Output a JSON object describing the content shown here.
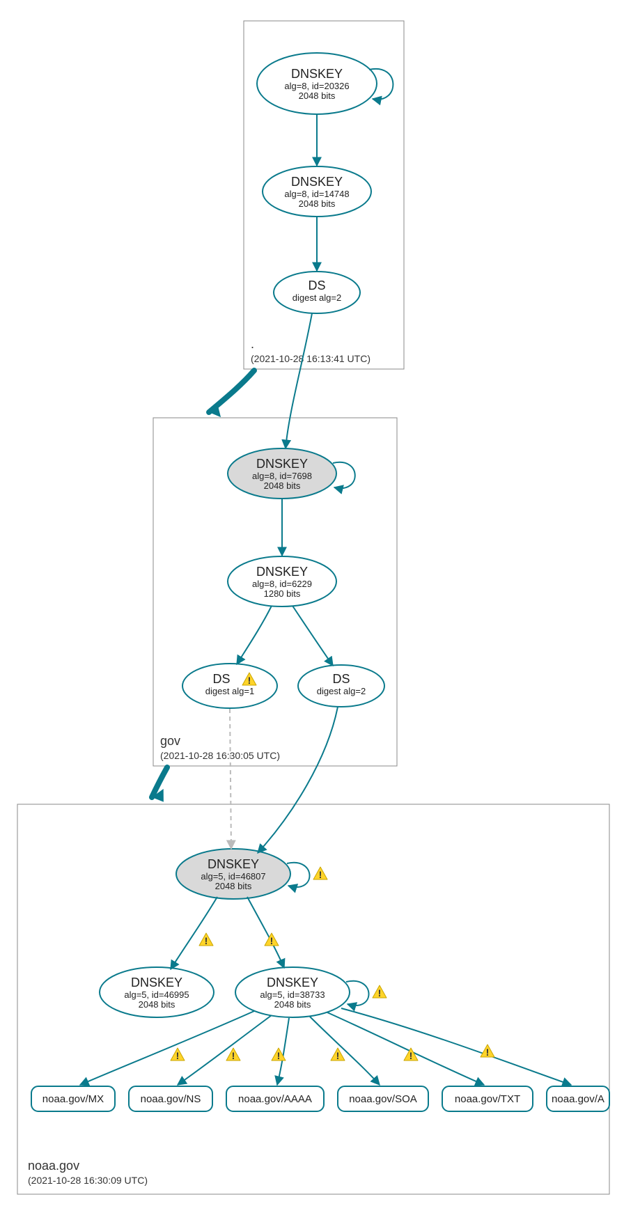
{
  "zones": {
    "root": {
      "title": ".",
      "timestamp": "(2021-10-28 16:13:41 UTC)"
    },
    "gov": {
      "title": "gov",
      "timestamp": "(2021-10-28 16:30:05 UTC)"
    },
    "noaa": {
      "title": "noaa.gov",
      "timestamp": "(2021-10-28 16:30:09 UTC)"
    }
  },
  "nodes": {
    "root_ksk": {
      "title": "DNSKEY",
      "line1": "alg=8, id=20326",
      "line2": "2048 bits"
    },
    "root_zsk": {
      "title": "DNSKEY",
      "line1": "alg=8, id=14748",
      "line2": "2048 bits"
    },
    "root_ds": {
      "title": "DS",
      "line1": "digest alg=2"
    },
    "gov_ksk": {
      "title": "DNSKEY",
      "line1": "alg=8, id=7698",
      "line2": "2048 bits"
    },
    "gov_zsk": {
      "title": "DNSKEY",
      "line1": "alg=8, id=6229",
      "line2": "1280 bits"
    },
    "gov_ds1": {
      "title": "DS",
      "line1": "digest alg=1"
    },
    "gov_ds2": {
      "title": "DS",
      "line1": "digest alg=2"
    },
    "noaa_ksk": {
      "title": "DNSKEY",
      "line1": "alg=5, id=46807",
      "line2": "2048 bits"
    },
    "noaa_zsk1": {
      "title": "DNSKEY",
      "line1": "alg=5, id=46995",
      "line2": "2048 bits"
    },
    "noaa_zsk2": {
      "title": "DNSKEY",
      "line1": "alg=5, id=38733",
      "line2": "2048 bits"
    },
    "rr_mx": {
      "title": "noaa.gov/MX"
    },
    "rr_ns": {
      "title": "noaa.gov/NS"
    },
    "rr_aaaa": {
      "title": "noaa.gov/AAAA"
    },
    "rr_soa": {
      "title": "noaa.gov/SOA"
    },
    "rr_txt": {
      "title": "noaa.gov/TXT"
    },
    "rr_a": {
      "title": "noaa.gov/A"
    }
  }
}
